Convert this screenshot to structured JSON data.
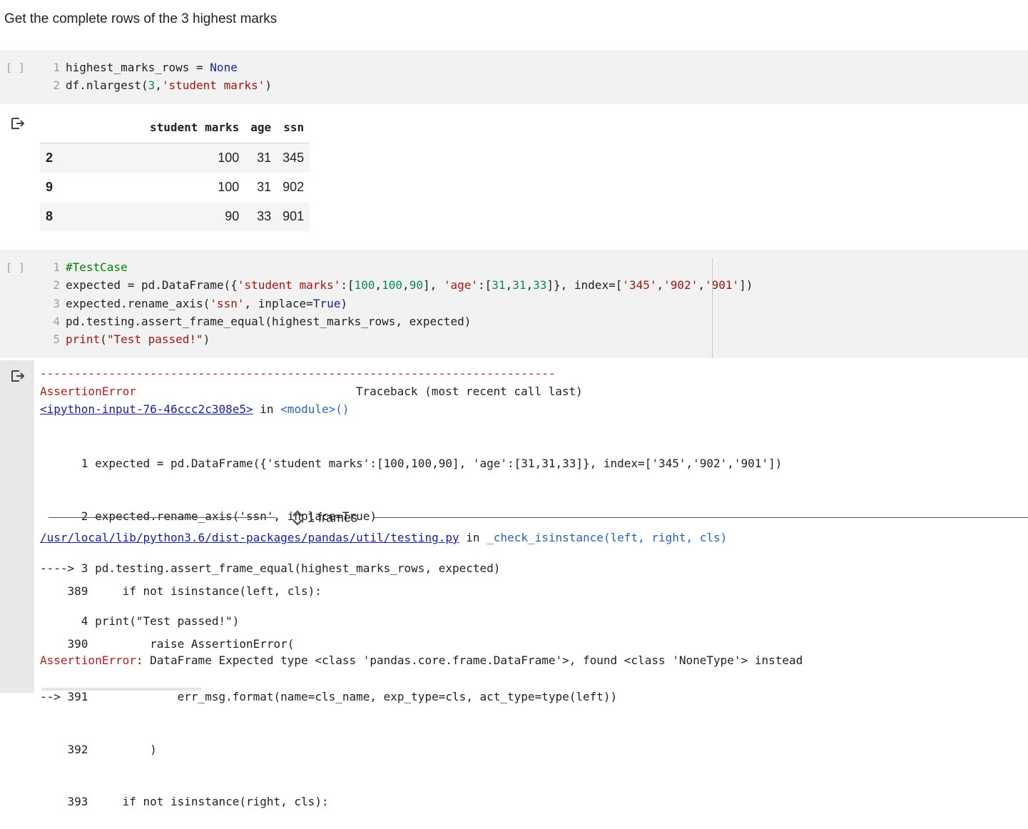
{
  "heading": "Get the complete rows of the 3 highest marks",
  "cell1": {
    "run_label": "[ ]",
    "lines": [
      {
        "n": "1",
        "html": "highest_marks_rows = <span class=\"kw\">None</span>"
      },
      {
        "n": "2",
        "html": "df.nlargest(<span class=\"num\">3</span>,<span class=\"str\">'student marks'</span>)"
      }
    ]
  },
  "output1": {
    "columns": [
      "",
      "student marks",
      "age",
      "ssn"
    ],
    "rows": [
      {
        "index": "2",
        "student_marks": "100",
        "age": "31",
        "ssn": "345"
      },
      {
        "index": "9",
        "student_marks": "100",
        "age": "31",
        "ssn": "902"
      },
      {
        "index": "8",
        "student_marks": "90",
        "age": "33",
        "ssn": "901"
      }
    ]
  },
  "cell2": {
    "run_label": "[ ]",
    "lines": [
      {
        "n": "1",
        "html": "<span class=\"cmt\">#TestCase</span>"
      },
      {
        "n": "2",
        "html": "expected = pd.DataFrame({<span class=\"str\">'student marks'</span>:[<span class=\"num\">100</span>,<span class=\"num\">100</span>,<span class=\"num\">90</span>], <span class=\"str\">'age'</span>:[<span class=\"num\">31</span>,<span class=\"num\">31</span>,<span class=\"num\">33</span>]}, index=[<span class=\"str\">'345'</span>,<span class=\"str\">'902'</span>,<span class=\"str\">'901'</span>])"
      },
      {
        "n": "3",
        "html": "expected.rename_axis(<span class=\"str\">'ssn'</span>, inplace=<span class=\"kw\">True</span>)"
      },
      {
        "n": "4",
        "html": "pd.testing.assert_frame_equal(highest_marks_rows, expected)"
      },
      {
        "n": "5",
        "html": "<span class=\"str\">print</span>(<span class=\"str\">\"Test passed!\"</span>)"
      }
    ]
  },
  "traceback": {
    "dashes": "---------------------------------------------------------------------------",
    "error_name": "AssertionError",
    "traceback_label": "Traceback (most recent call last)",
    "input_link": "<ipython-input-76-46ccc2c308e5>",
    "in_word": "in",
    "module": "<module>()",
    "frames_label": "1 frames",
    "file_link": "/usr/local/lib/python3.6/dist-packages/pandas/util/testing.py",
    "func": "_check_isinstance(left, right, cls)",
    "final_error_name": "AssertionError",
    "final_message": ": DataFrame Expected type <class 'pandas.core.frame.DataFrame'>, found <class 'NoneType'> instead",
    "block1": [
      "      1 expected = pd.DataFrame({'student marks':[100,100,90], 'age':[31,31,33]}, index=['345','902','901'])",
      "      2 expected.rename_axis('ssn', inplace=True)",
      "----> 3 pd.testing.assert_frame_equal(highest_marks_rows, expected)",
      "      4 print(\"Test passed!\")"
    ],
    "block2": [
      "    389     if not isinstance(left, cls):",
      "    390         raise AssertionError(",
      "--> 391             err_msg.format(name=cls_name, exp_type=cls, act_type=type(left))",
      "    392         )",
      "    393     if not isinstance(right, cls):"
    ]
  }
}
